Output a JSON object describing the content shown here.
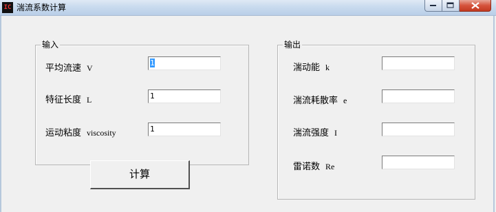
{
  "window": {
    "title": "湍流系数计算",
    "icon_text": "IC",
    "icons": {
      "app": "app-logo-icon",
      "minimize": "minimize-icon",
      "maximize": "maximize-icon",
      "close": "close-icon"
    },
    "close_color": "#c9402a"
  },
  "input_group": {
    "title": "输入",
    "fields": [
      {
        "label": "平均流速",
        "symbol": "V",
        "value": "1",
        "selected": true
      },
      {
        "label": "特征长度",
        "symbol": "L",
        "value": "1"
      },
      {
        "label": "运动粘度",
        "symbol": "viscosity",
        "value": "1"
      }
    ]
  },
  "output_group": {
    "title": "输出",
    "fields": [
      {
        "label": "湍动能",
        "symbol": "k",
        "value": ""
      },
      {
        "label": "湍流耗散率",
        "symbol": "e",
        "value": ""
      },
      {
        "label": "湍流强度",
        "symbol": "I",
        "value": ""
      },
      {
        "label": "雷诺数",
        "symbol": "Re",
        "value": ""
      }
    ]
  },
  "calculate_button": {
    "label": "计算"
  }
}
